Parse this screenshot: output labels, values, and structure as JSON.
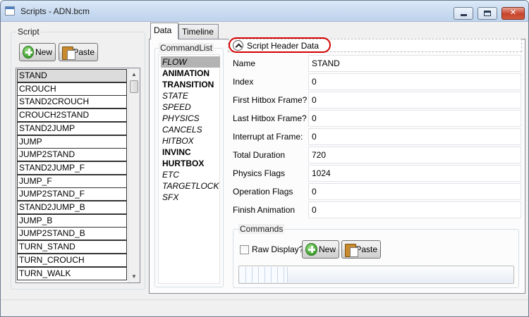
{
  "window": {
    "title": "Scripts - ADN.bcm",
    "min_glyph": "",
    "max_glyph": "",
    "close_glyph": "✕"
  },
  "script_panel": {
    "group_title": "Script",
    "new_label": "New",
    "paste_label": "Paste",
    "items": [
      "STAND",
      "CROUCH",
      "STAND2CROUCH",
      "CROUCH2STAND",
      "STAND2JUMP",
      "JUMP",
      "JUMP2STAND",
      "STAND2JUMP_F",
      "JUMP_F",
      "JUMP2STAND_F",
      "STAND2JUMP_B",
      "JUMP_B",
      "JUMP2STAND_B",
      "TURN_STAND",
      "TURN_CROUCH",
      "TURN_WALK"
    ],
    "selected": "STAND"
  },
  "tabs": [
    {
      "label": "Data",
      "active": true
    },
    {
      "label": "Timeline",
      "active": false
    }
  ],
  "command_list": {
    "group_title": "CommandList",
    "items": [
      {
        "label": "FLOW",
        "style": "selected"
      },
      {
        "label": "ANIMATION",
        "style": "bold"
      },
      {
        "label": "TRANSITION",
        "style": "bold"
      },
      {
        "label": "STATE",
        "style": "italic"
      },
      {
        "label": "SPEED",
        "style": "italic"
      },
      {
        "label": "PHYSICS",
        "style": "italic"
      },
      {
        "label": "CANCELS",
        "style": "italic"
      },
      {
        "label": "HITBOX",
        "style": "italic"
      },
      {
        "label": "INVINC",
        "style": "bold"
      },
      {
        "label": "HURTBOX",
        "style": "bold"
      },
      {
        "label": "ETC",
        "style": "italic"
      },
      {
        "label": "TARGETLOCK",
        "style": "italic"
      },
      {
        "label": "SFX",
        "style": "italic"
      }
    ]
  },
  "header_data": {
    "expander_label": "Script Header Data",
    "highlight_color": "#d40000",
    "fields": [
      {
        "label": "Name",
        "value": "STAND"
      },
      {
        "label": "Index",
        "value": "0"
      },
      {
        "label": "First Hitbox Frame?",
        "value": "0"
      },
      {
        "label": "Last Hitbox Frame?",
        "value": "0"
      },
      {
        "label": "Interrupt at Frame:",
        "value": "0"
      },
      {
        "label": "Total Duration",
        "value": "720"
      },
      {
        "label": "Physics Flags",
        "value": "1024"
      },
      {
        "label": "Operation Flags",
        "value": "0"
      },
      {
        "label": "Finish Animation",
        "value": "0"
      }
    ]
  },
  "commands": {
    "group_title": "Commands",
    "raw_display_label": "Raw Display?",
    "raw_display_checked": false,
    "new_label": "New",
    "paste_label": "Paste"
  }
}
